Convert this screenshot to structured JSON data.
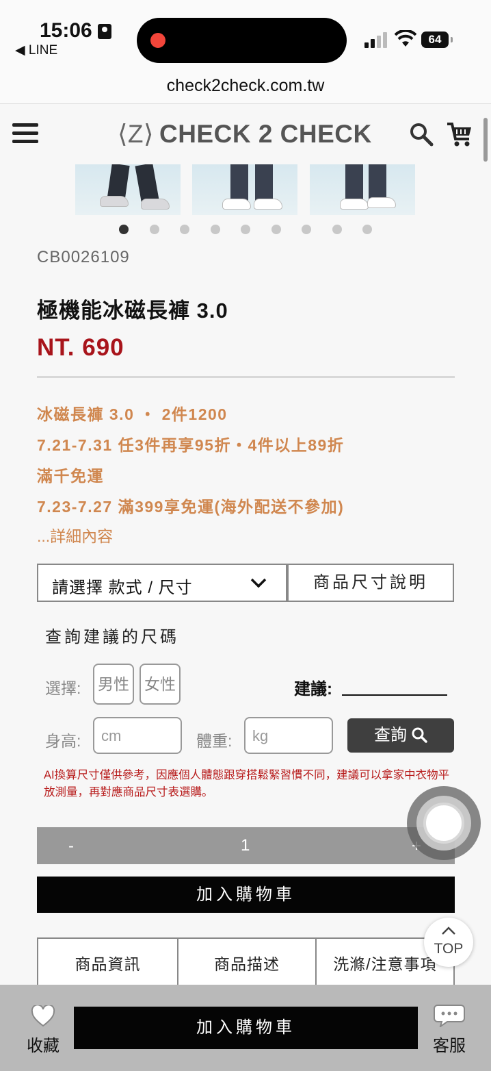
{
  "status_bar": {
    "time": "15:06",
    "back_app": "◀ LINE",
    "battery": "64"
  },
  "browser": {
    "url": "check2check.com.tw"
  },
  "header": {
    "logo_text": "CHECK 2 CHECK",
    "logo_mark": "⟨Z⟩"
  },
  "gallery": {
    "image_count": 9,
    "active_index": 0
  },
  "product": {
    "sku": "CB0026109",
    "name": "極機能冰磁長褲 3.0",
    "price": "NT. 690"
  },
  "promotions": [
    "冰磁長褲 3.0 ・ 2件1200",
    "7.21-7.31 任3件再享95折・4件以上89折",
    "滿千免運",
    "7.23-7.27 滿399享免運(海外配送不參加)"
  ],
  "more_details": "...詳細內容",
  "options": {
    "select_placeholder": "請選擇 款式 / 尺寸",
    "size_guide": "商品尺寸說明"
  },
  "size_query": {
    "title": "查詢建議的尺碼",
    "choose_label": "選擇:",
    "male": "男性",
    "female": "女性",
    "suggest_label": "建議:",
    "height_label": "身高:",
    "height_placeholder": "cm",
    "weight_label": "體重:",
    "weight_placeholder": "kg",
    "query_button": "查詢",
    "disclaimer": "AI換算尺寸僅供參考，因應個人體態跟穿搭鬆緊習慣不同，建議可以拿家中衣物平放測量，再對應商品尺寸表選購。"
  },
  "quantity": {
    "minus": "-",
    "value": "1",
    "plus": "+"
  },
  "add_to_cart": "加入購物車",
  "tabs": [
    "商品資訊",
    "商品描述",
    "洗滌/注意事項"
  ],
  "top_button": "TOP",
  "bottom_bar": {
    "favorite": "收藏",
    "add_to_cart": "加入購物車",
    "customer_service": "客服"
  }
}
